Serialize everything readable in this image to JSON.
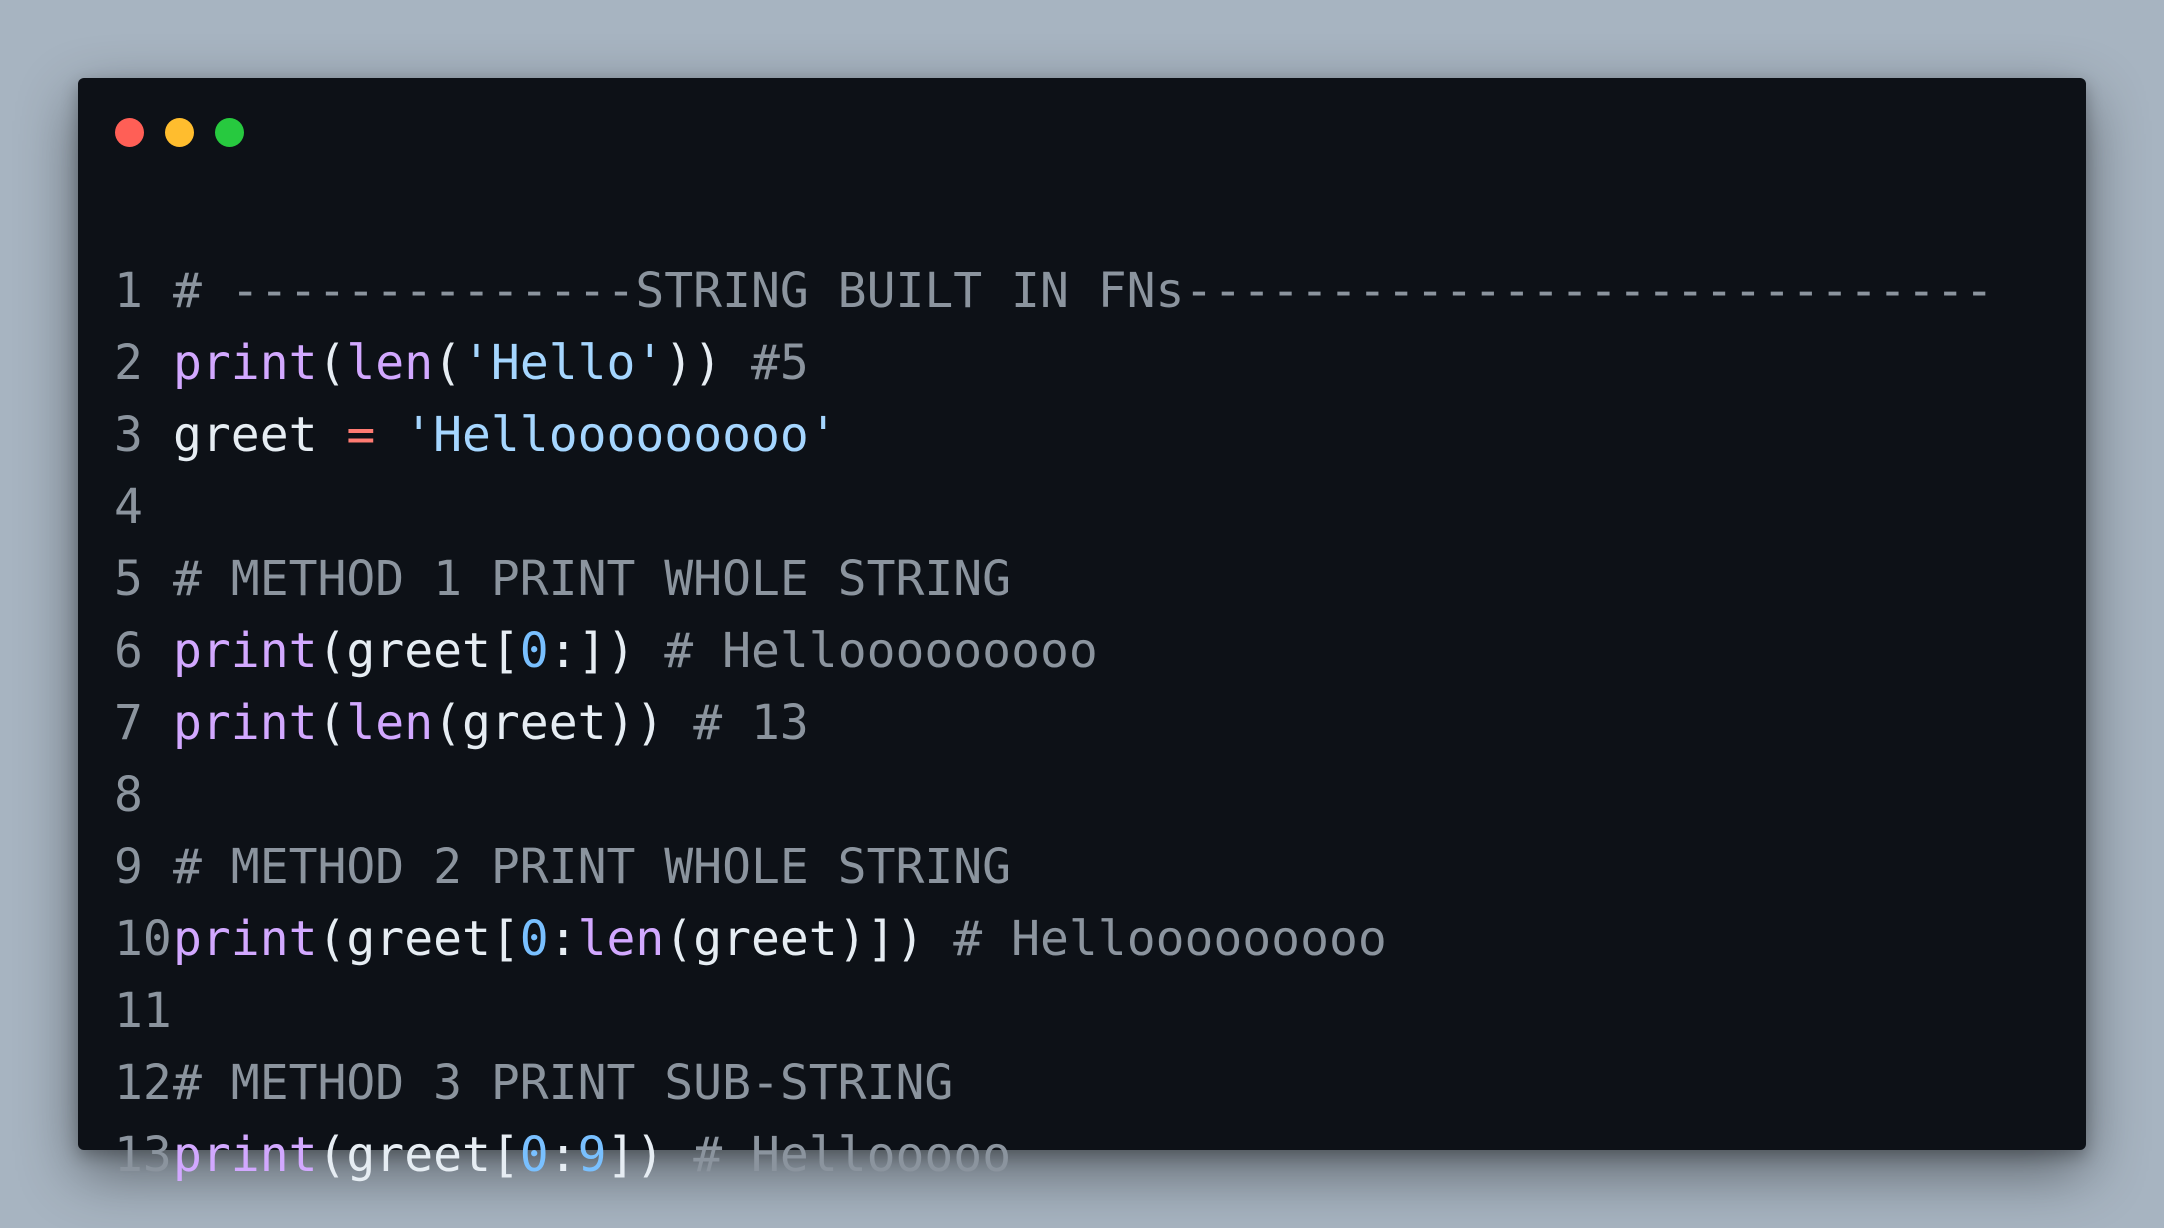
{
  "window": {
    "controls": [
      {
        "name": "close",
        "color": "#ff5f56"
      },
      {
        "name": "minimize",
        "color": "#ffbd2e"
      },
      {
        "name": "zoom",
        "color": "#27c93f"
      }
    ]
  },
  "theme": {
    "background": "#0d1117",
    "comment": "#8b949e",
    "keyword": "#d2a8ff",
    "string": "#a5d6ff",
    "number": "#79c0ff",
    "operator": "#ff7b72",
    "text": "#e6edf3"
  },
  "code": {
    "language": "python",
    "lines": [
      {
        "number": "1",
        "tokens": [
          {
            "t": "c",
            "v": "# --------------STRING BUILT IN FNs----------------------------"
          }
        ]
      },
      {
        "number": "2",
        "tokens": [
          {
            "t": "k",
            "v": "print"
          },
          {
            "t": "p",
            "v": "("
          },
          {
            "t": "k",
            "v": "len"
          },
          {
            "t": "p",
            "v": "("
          },
          {
            "t": "s",
            "v": "'Hello'"
          },
          {
            "t": "p",
            "v": ")) "
          },
          {
            "t": "c",
            "v": "#5"
          }
        ]
      },
      {
        "number": "3",
        "tokens": [
          {
            "t": "p",
            "v": "greet "
          },
          {
            "t": "o",
            "v": "="
          },
          {
            "t": "p",
            "v": " "
          },
          {
            "t": "s",
            "v": "'Hellooooooooo'"
          }
        ]
      },
      {
        "number": "4",
        "tokens": []
      },
      {
        "number": "5",
        "tokens": [
          {
            "t": "c",
            "v": "# METHOD 1 PRINT WHOLE STRING"
          }
        ]
      },
      {
        "number": "6",
        "tokens": [
          {
            "t": "k",
            "v": "print"
          },
          {
            "t": "p",
            "v": "(greet["
          },
          {
            "t": "n",
            "v": "0"
          },
          {
            "t": "p",
            "v": ":]) "
          },
          {
            "t": "c",
            "v": "# Hellooooooooo"
          }
        ]
      },
      {
        "number": "7",
        "tokens": [
          {
            "t": "k",
            "v": "print"
          },
          {
            "t": "p",
            "v": "("
          },
          {
            "t": "k",
            "v": "len"
          },
          {
            "t": "p",
            "v": "(greet)) "
          },
          {
            "t": "c",
            "v": "# 13"
          }
        ]
      },
      {
        "number": "8",
        "tokens": []
      },
      {
        "number": "9",
        "tokens": [
          {
            "t": "c",
            "v": "# METHOD 2 PRINT WHOLE STRING"
          }
        ]
      },
      {
        "number": "10",
        "tokens": [
          {
            "t": "k",
            "v": "print"
          },
          {
            "t": "p",
            "v": "(greet["
          },
          {
            "t": "n",
            "v": "0"
          },
          {
            "t": "p",
            "v": ":"
          },
          {
            "t": "k",
            "v": "len"
          },
          {
            "t": "p",
            "v": "(greet)]) "
          },
          {
            "t": "c",
            "v": "# Hellooooooooo"
          }
        ]
      },
      {
        "number": "11",
        "tokens": []
      },
      {
        "number": "12",
        "tokens": [
          {
            "t": "c",
            "v": "# METHOD 3 PRINT SUB-STRING"
          }
        ]
      },
      {
        "number": "13",
        "tokens": [
          {
            "t": "k",
            "v": "print"
          },
          {
            "t": "p",
            "v": "(greet["
          },
          {
            "t": "n",
            "v": "0"
          },
          {
            "t": "p",
            "v": ":"
          },
          {
            "t": "n",
            "v": "9"
          },
          {
            "t": "p",
            "v": "]) "
          },
          {
            "t": "c",
            "v": "# Hellooooo"
          }
        ]
      }
    ]
  }
}
